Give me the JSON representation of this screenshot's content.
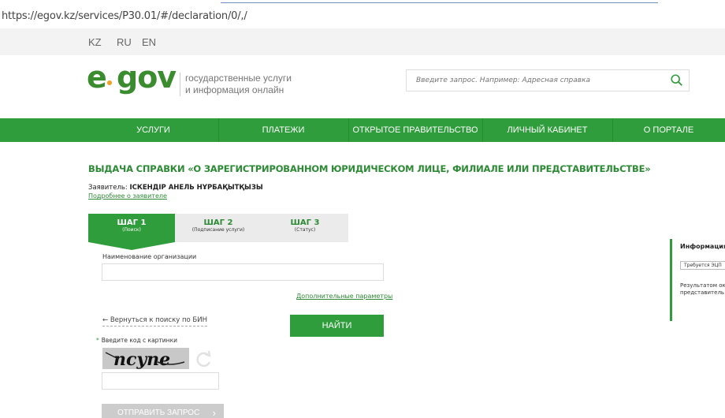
{
  "browser": {
    "url": "https://egov.kz/services/P30.01/#/declaration/0/,/"
  },
  "languages": [
    "KZ",
    "RU",
    "EN"
  ],
  "logo": {
    "text_e": "e",
    "text_gov": "gov"
  },
  "tagline": {
    "line1": "государственные услуги",
    "line2": "и информация онлайн"
  },
  "search": {
    "placeholder": "Введите запрос. Например: Адресная справка",
    "icon": "search-icon"
  },
  "nav": [
    "УСЛУГИ",
    "ПЛАТЕЖИ",
    "ОТКРЫТОЕ ПРАВИТЕЛЬСТВО",
    "ЛИЧНЫЙ КАБИНЕТ",
    "О ПОРТАЛЕ"
  ],
  "page": {
    "title": "ВЫДАЧА СПРАВКИ «О ЗАРЕГИСТРИРОВАННОМ ЮРИДИЧЕСКОМ ЛИЦЕ, ФИЛИАЛЕ ИЛИ ПРЕДСТАВИТЕЛЬСТВЕ»",
    "applicant_label": "Заявитель:",
    "applicant_name": "ІСКЕНДІР АНЕЛЬ НҰРБАҚЫТҚЫЗЫ",
    "more_link": "Подробнее о заявителе"
  },
  "steps": [
    {
      "title": "ШАГ 1",
      "subtitle": "(Поиск)"
    },
    {
      "title": "ШАГ 2",
      "subtitle": "(Подписание услуги)"
    },
    {
      "title": "ШАГ 3",
      "subtitle": "(Статус)"
    }
  ],
  "form": {
    "org_label": "Наименование организации",
    "org_value": "",
    "more_params": "Дополнительные параметры",
    "back_link": "← Вернуться к поиску по БИН",
    "find_button": "НАЙТИ",
    "captcha_label": "Введите код с картинки",
    "captcha_text": "ncyne",
    "captcha_value": "",
    "send_button": "ОТПРАВИТЬ ЗАПРОС",
    "send_chevron": "›"
  },
  "info": {
    "heading": "Информация о",
    "badge": "Требуется ЭЦП",
    "text": "Результатом оказания зарегистрирован представитель"
  },
  "colors": {
    "brand_green": "#2f9d3b",
    "title_green": "#2c8a35",
    "logo_orange": "#f0a020"
  }
}
